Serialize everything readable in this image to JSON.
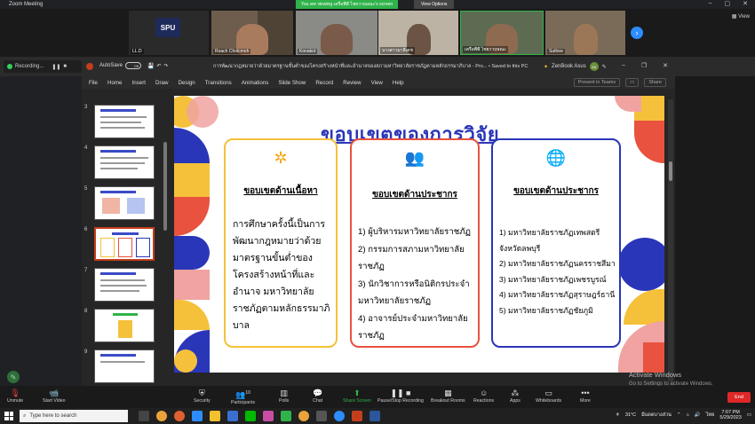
{
  "zoom": {
    "app_title": "Zoom Meeting",
    "banner": "You are viewing เครือพีพี ไชยวาฤษณะ's screen",
    "view_options": "View Options",
    "view_label": "View",
    "participants_tiles": [
      {
        "name": "LL.D",
        "logo": "SPU"
      },
      {
        "name": "Roach Cholcmoh"
      },
      {
        "name": "Konakot"
      },
      {
        "name": "นางสาวมาลีเดช"
      },
      {
        "name": "เครือพีพี ไชยวาฤษณะ"
      },
      {
        "name": "Suthee"
      }
    ]
  },
  "ppt": {
    "recording": "Recording...",
    "autosave": "AutoSave",
    "autosave_state": "Off",
    "doc_title": "การพัฒนากฎหมายว่าด้วยมาตรฐานขั้นต่ำของโครงสร้างหน้าที่และอำนาจของสภามหาวิทยาลัยราชภัฏตามหลักธรรมาภิบาล - Pro... • Saved to this PC",
    "user_name": "ZenBook Asus",
    "user_initials": "ZA",
    "menu": [
      "File",
      "Home",
      "Insert",
      "Draw",
      "Design",
      "Transitions",
      "Animations",
      "Slide Show",
      "Record",
      "Review",
      "View",
      "Help"
    ],
    "present_in_teams": "Present in Teams",
    "share": "Share",
    "thumbnails": [
      "3",
      "4",
      "5",
      "6",
      "7",
      "8",
      "9"
    ]
  },
  "slide": {
    "title": "ขอบเขตของการวิจัย",
    "cards": [
      {
        "heading": "ขอบเขตด้านเนื้อหา",
        "body": "การศึกษาครั้งนี้เป็นการพัฒนากฎหมายว่าด้วยมาตรฐานขั้นต่ำของโครงสร้างหน้าที่และอำนาจ มหาวิทยาลัยราชภัฏตามหลักธรรมาภิบาล"
      },
      {
        "heading": "ขอบเขตด้านประชากร",
        "items": [
          "1) ผู้บริหารมหาวิทยาลัยราชภัฏ",
          "2) กรรมการสภามหาวิทยาลัยราชภัฏ",
          "3) นักวิชาการหรือนิติกรประจำมหาวิทยาลัยราชภัฏ",
          "4) อาจารย์ประจำมหาวิทยาลัยราชภัฏ"
        ]
      },
      {
        "heading": "ขอบเขตด้านประชากร",
        "items": [
          "1) มหาวิทยาลัยราชภัฏเทพสตรี จังหวัดลพบุรี",
          "2) มหาวิทยาลัยราชภัฏนครราชสีมา",
          "3) มหาวิทยาลัยราชภัฏเพชรบูรณ์",
          "4) มหาวิทยาลัยราชภัฏสุราษฎร์ธานี",
          "5) มหาวิทยาลัยราชภัฏชัยภูมิ"
        ]
      }
    ]
  },
  "watermark": {
    "line1": "Activate Windows",
    "line2": "Go to Settings to activate Windows."
  },
  "toolbar": {
    "items": [
      {
        "label": "Unmute",
        "icon": "mic-off-icon"
      },
      {
        "label": "Start Video",
        "icon": "video-off-icon"
      },
      {
        "label": "Security",
        "icon": "shield-icon"
      },
      {
        "label": "Participants",
        "icon": "people-icon",
        "count": "10"
      },
      {
        "label": "Polls",
        "icon": "poll-icon"
      },
      {
        "label": "Chat",
        "icon": "chat-icon"
      },
      {
        "label": "Share Screen",
        "icon": "share-icon"
      },
      {
        "label": "Pause/Stop Recording",
        "icon": "pause-icon"
      },
      {
        "label": "Breakout Rooms",
        "icon": "rooms-icon"
      },
      {
        "label": "Reactions",
        "icon": "smile-icon"
      },
      {
        "label": "Apps",
        "icon": "apps-icon"
      },
      {
        "label": "Whiteboards",
        "icon": "whiteboard-icon"
      },
      {
        "label": "More",
        "icon": "more-icon"
      }
    ],
    "end": "End"
  },
  "taskbar": {
    "search_placeholder": "Type here to search",
    "temperature": "31°C",
    "weather": "มีแดดบางส่วน",
    "lang": "ไทย",
    "time": "7:07 PM",
    "date": "5/29/2023"
  },
  "colors": {
    "title_blue": "#2a36b8",
    "card1_border": "#f5c13a",
    "card2_border": "#e8523f",
    "card3_border": "#2a36b8",
    "zoom_green": "#2fb34a",
    "end_red": "#e02828"
  }
}
